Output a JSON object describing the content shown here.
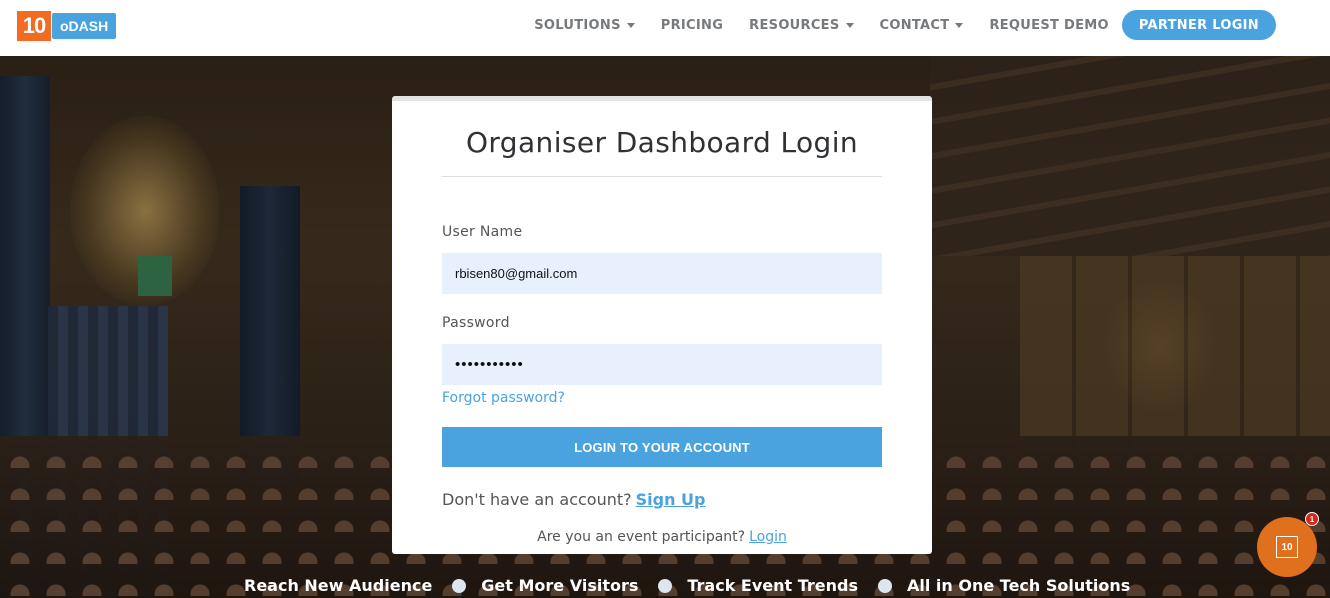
{
  "header": {
    "logo_number": "10",
    "logo_word": "oDASH",
    "nav": [
      {
        "label": "SOLUTIONS",
        "dropdown": true
      },
      {
        "label": "PRICING",
        "dropdown": false
      },
      {
        "label": "RESOURCES",
        "dropdown": true
      },
      {
        "label": "CONTACT",
        "dropdown": true
      },
      {
        "label": "REQUEST DEMO",
        "dropdown": false
      }
    ],
    "partner_login_label": "PARTNER LOGIN"
  },
  "login": {
    "title": "Organiser Dashboard Login",
    "username_label": "User Name",
    "username_value": "rbisen80@gmail.com",
    "password_label": "Password",
    "password_value": "•••••••••••",
    "forgot_label": "Forgot password?",
    "submit_label": "LOGIN TO YOUR ACCOUNT",
    "signup_prompt": "Don't have an account?",
    "signup_link": "Sign Up",
    "participant_prompt": "Are you an event participant?",
    "participant_link": "Login"
  },
  "ticker": [
    "Reach New Audience",
    "Get More Visitors",
    "Track Event Trends",
    "All in One Tech Solutions"
  ],
  "chat_widget": {
    "icon_text": "10",
    "badge_count": "1"
  },
  "colors": {
    "brand_orange": "#f26b21",
    "brand_blue": "#4aa3df",
    "input_bg": "#e8f0fe"
  }
}
